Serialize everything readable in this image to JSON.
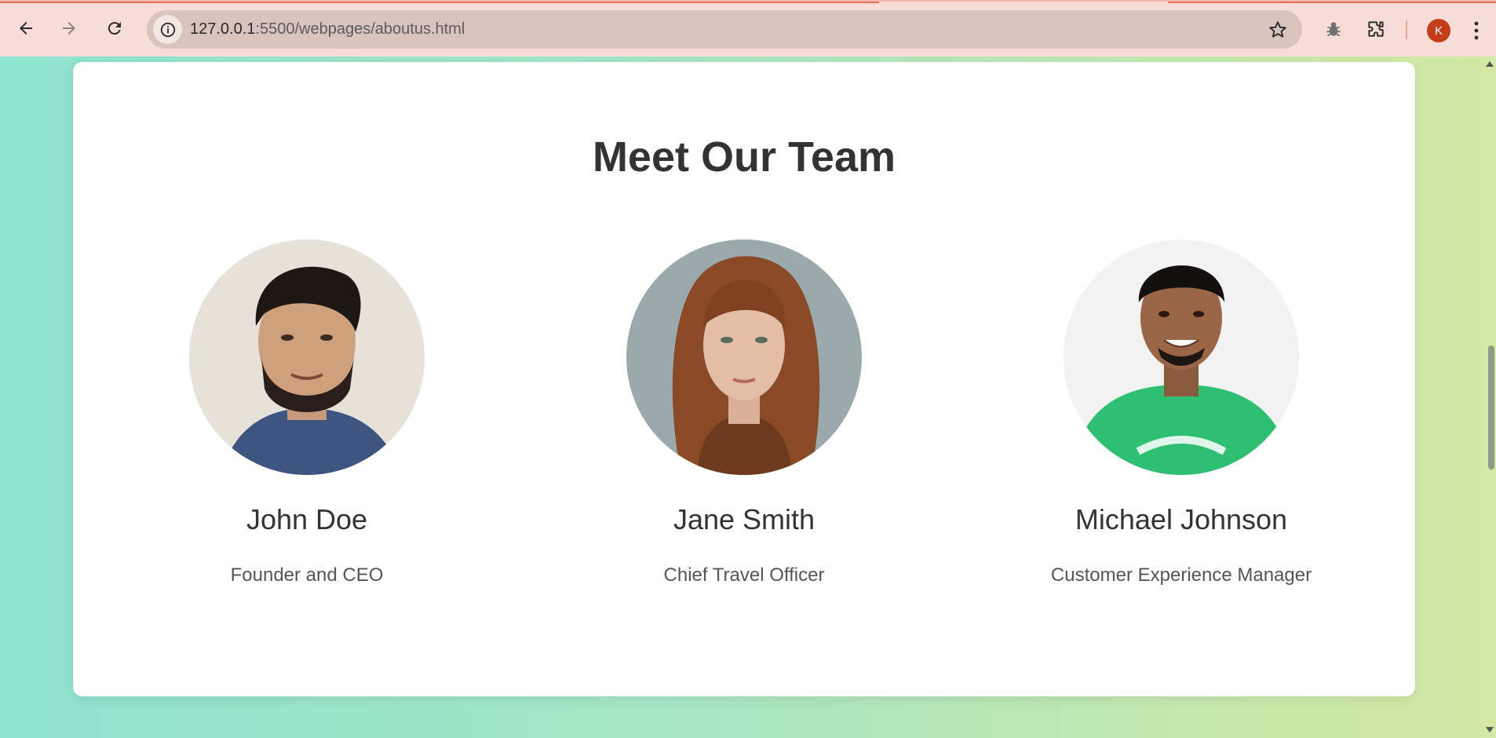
{
  "browser": {
    "url_host": "127.0.0.1",
    "url_rest": ":5500/webpages/aboutus.html",
    "profile_initial": "K",
    "icons": [
      "back-arrow-icon",
      "forward-arrow-icon",
      "reload-icon",
      "info-icon",
      "star-icon",
      "bug-icon",
      "puzzle-icon",
      "kebab-menu-icon"
    ]
  },
  "section": {
    "title": "Meet Our Team"
  },
  "team": [
    {
      "name": "John Doe",
      "role": "Founder and CEO"
    },
    {
      "name": "Jane Smith",
      "role": "Chief Travel Officer"
    },
    {
      "name": "Michael Johnson",
      "role": "Customer Experience Manager"
    }
  ],
  "colors": {
    "chrome_bg": "#f8ddd6",
    "omnibox_bg": "#d9c4bd",
    "avatar_bg": "#c43d1a",
    "heading": "#333333",
    "role_text": "#555555"
  }
}
